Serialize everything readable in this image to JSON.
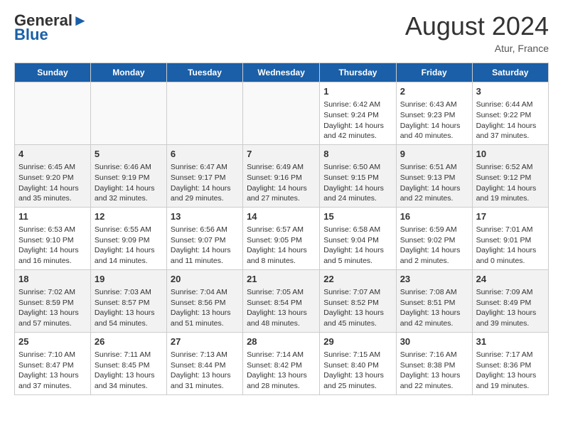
{
  "header": {
    "logo_general": "General",
    "logo_blue": "Blue",
    "month_title": "August 2024",
    "location": "Atur, France"
  },
  "columns": [
    "Sunday",
    "Monday",
    "Tuesday",
    "Wednesday",
    "Thursday",
    "Friday",
    "Saturday"
  ],
  "weeks": [
    [
      {
        "day": "",
        "info": ""
      },
      {
        "day": "",
        "info": ""
      },
      {
        "day": "",
        "info": ""
      },
      {
        "day": "",
        "info": ""
      },
      {
        "day": "1",
        "info": "Sunrise: 6:42 AM\nSunset: 9:24 PM\nDaylight: 14 hours and 42 minutes."
      },
      {
        "day": "2",
        "info": "Sunrise: 6:43 AM\nSunset: 9:23 PM\nDaylight: 14 hours and 40 minutes."
      },
      {
        "day": "3",
        "info": "Sunrise: 6:44 AM\nSunset: 9:22 PM\nDaylight: 14 hours and 37 minutes."
      }
    ],
    [
      {
        "day": "4",
        "info": "Sunrise: 6:45 AM\nSunset: 9:20 PM\nDaylight: 14 hours and 35 minutes."
      },
      {
        "day": "5",
        "info": "Sunrise: 6:46 AM\nSunset: 9:19 PM\nDaylight: 14 hours and 32 minutes."
      },
      {
        "day": "6",
        "info": "Sunrise: 6:47 AM\nSunset: 9:17 PM\nDaylight: 14 hours and 29 minutes."
      },
      {
        "day": "7",
        "info": "Sunrise: 6:49 AM\nSunset: 9:16 PM\nDaylight: 14 hours and 27 minutes."
      },
      {
        "day": "8",
        "info": "Sunrise: 6:50 AM\nSunset: 9:15 PM\nDaylight: 14 hours and 24 minutes."
      },
      {
        "day": "9",
        "info": "Sunrise: 6:51 AM\nSunset: 9:13 PM\nDaylight: 14 hours and 22 minutes."
      },
      {
        "day": "10",
        "info": "Sunrise: 6:52 AM\nSunset: 9:12 PM\nDaylight: 14 hours and 19 minutes."
      }
    ],
    [
      {
        "day": "11",
        "info": "Sunrise: 6:53 AM\nSunset: 9:10 PM\nDaylight: 14 hours and 16 minutes."
      },
      {
        "day": "12",
        "info": "Sunrise: 6:55 AM\nSunset: 9:09 PM\nDaylight: 14 hours and 14 minutes."
      },
      {
        "day": "13",
        "info": "Sunrise: 6:56 AM\nSunset: 9:07 PM\nDaylight: 14 hours and 11 minutes."
      },
      {
        "day": "14",
        "info": "Sunrise: 6:57 AM\nSunset: 9:05 PM\nDaylight: 14 hours and 8 minutes."
      },
      {
        "day": "15",
        "info": "Sunrise: 6:58 AM\nSunset: 9:04 PM\nDaylight: 14 hours and 5 minutes."
      },
      {
        "day": "16",
        "info": "Sunrise: 6:59 AM\nSunset: 9:02 PM\nDaylight: 14 hours and 2 minutes."
      },
      {
        "day": "17",
        "info": "Sunrise: 7:01 AM\nSunset: 9:01 PM\nDaylight: 14 hours and 0 minutes."
      }
    ],
    [
      {
        "day": "18",
        "info": "Sunrise: 7:02 AM\nSunset: 8:59 PM\nDaylight: 13 hours and 57 minutes."
      },
      {
        "day": "19",
        "info": "Sunrise: 7:03 AM\nSunset: 8:57 PM\nDaylight: 13 hours and 54 minutes."
      },
      {
        "day": "20",
        "info": "Sunrise: 7:04 AM\nSunset: 8:56 PM\nDaylight: 13 hours and 51 minutes."
      },
      {
        "day": "21",
        "info": "Sunrise: 7:05 AM\nSunset: 8:54 PM\nDaylight: 13 hours and 48 minutes."
      },
      {
        "day": "22",
        "info": "Sunrise: 7:07 AM\nSunset: 8:52 PM\nDaylight: 13 hours and 45 minutes."
      },
      {
        "day": "23",
        "info": "Sunrise: 7:08 AM\nSunset: 8:51 PM\nDaylight: 13 hours and 42 minutes."
      },
      {
        "day": "24",
        "info": "Sunrise: 7:09 AM\nSunset: 8:49 PM\nDaylight: 13 hours and 39 minutes."
      }
    ],
    [
      {
        "day": "25",
        "info": "Sunrise: 7:10 AM\nSunset: 8:47 PM\nDaylight: 13 hours and 37 minutes."
      },
      {
        "day": "26",
        "info": "Sunrise: 7:11 AM\nSunset: 8:45 PM\nDaylight: 13 hours and 34 minutes."
      },
      {
        "day": "27",
        "info": "Sunrise: 7:13 AM\nSunset: 8:44 PM\nDaylight: 13 hours and 31 minutes."
      },
      {
        "day": "28",
        "info": "Sunrise: 7:14 AM\nSunset: 8:42 PM\nDaylight: 13 hours and 28 minutes."
      },
      {
        "day": "29",
        "info": "Sunrise: 7:15 AM\nSunset: 8:40 PM\nDaylight: 13 hours and 25 minutes."
      },
      {
        "day": "30",
        "info": "Sunrise: 7:16 AM\nSunset: 8:38 PM\nDaylight: 13 hours and 22 minutes."
      },
      {
        "day": "31",
        "info": "Sunrise: 7:17 AM\nSunset: 8:36 PM\nDaylight: 13 hours and 19 minutes."
      }
    ]
  ]
}
